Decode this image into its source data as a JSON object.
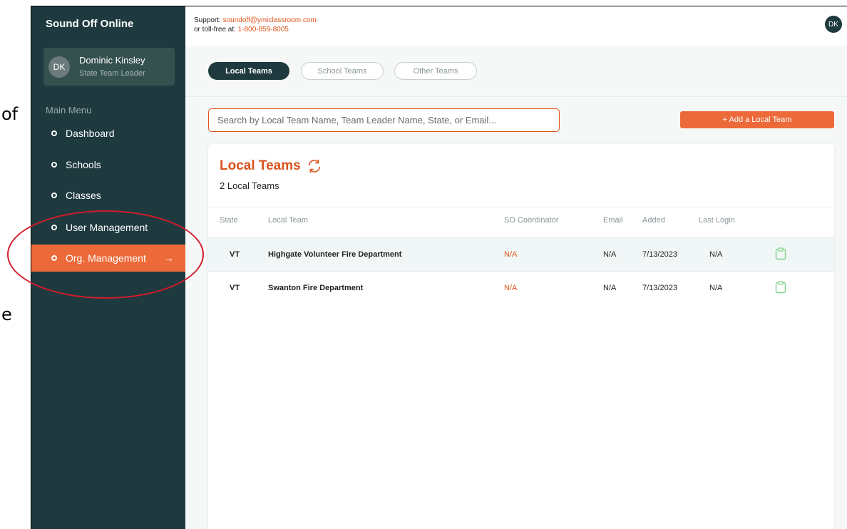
{
  "slide_edge": {
    "frag_top": "of",
    "frag_bottom": "e"
  },
  "app": {
    "brand": "Sound Off Online",
    "user": {
      "initials": "DK",
      "name": "Dominic Kinsley",
      "role": "State Team Leader"
    },
    "menu_label": "Main Menu",
    "menu": [
      {
        "label": "Dashboard"
      },
      {
        "label": "Schools"
      },
      {
        "label": "Classes"
      },
      {
        "label": "User Management"
      },
      {
        "label": "Org. Management",
        "active": true
      }
    ],
    "menu_arrow": "→"
  },
  "topbar": {
    "support_prefix": "Support: ",
    "support_email": "soundoff@ymiclassroom.com",
    "tollfree_prefix": "or toll-free at: ",
    "tollfree_number": "1-800-859-8005",
    "avatar_initials": "DK"
  },
  "tabs": [
    "Local Teams",
    "School Teams",
    "Other Teams"
  ],
  "search": {
    "placeholder": "Search by Local Team Name, Team Leader Name, State, or Email...",
    "value": ""
  },
  "add_button": "+ Add a Local Team",
  "card": {
    "title": "Local Teams",
    "count": "2 Local Teams",
    "columns": [
      "State",
      "Local Team",
      "SO Coordinator",
      "Email",
      "Added",
      "Last Login"
    ],
    "rows": [
      {
        "state": "VT",
        "team": "Highgate Volunteer Fire Department",
        "coordinator": "N/A",
        "email": "N/A",
        "added": "7/13/2023",
        "last_login": "N/A"
      },
      {
        "state": "VT",
        "team": "Swanton Fire Department",
        "coordinator": "N/A",
        "email": "N/A",
        "added": "7/13/2023",
        "last_login": "N/A"
      }
    ]
  },
  "colors": {
    "sidebar": "#1e3a3f",
    "accent": "#ec6a3a",
    "annotation": "#d21b2a"
  },
  "icons": [
    "refresh-icon",
    "clipboard-icon",
    "chevron-down-icon",
    "arrow-right-icon"
  ]
}
